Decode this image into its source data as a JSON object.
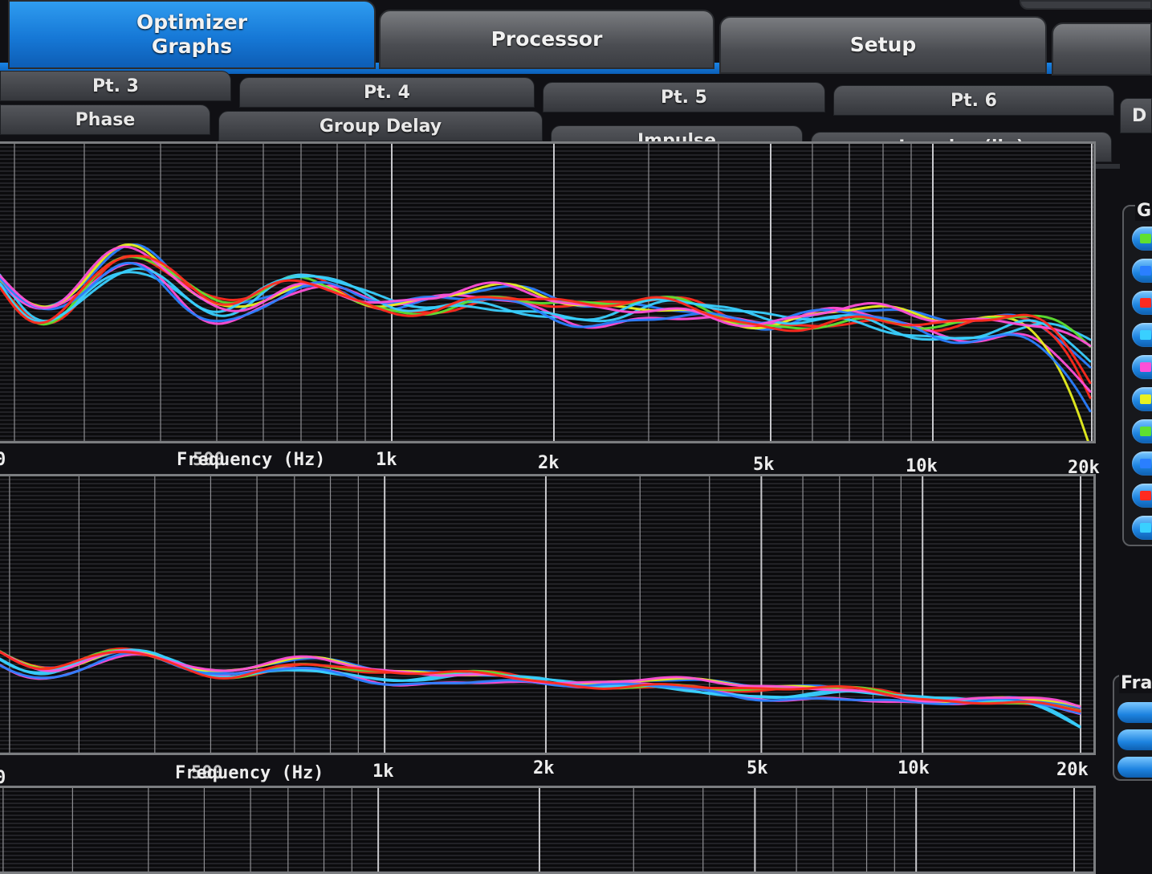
{
  "main_tabs": [
    {
      "label": "Optimizer\nGraphs",
      "active": true
    },
    {
      "label": "Processor",
      "active": false
    },
    {
      "label": "Setup",
      "active": false
    },
    {
      "label": "",
      "active": false
    }
  ],
  "point_tabs": [
    "Pt. 3",
    "Pt. 4",
    "Pt. 5",
    "Pt. 6"
  ],
  "graph_tabs": [
    "Phase",
    "Group Delay",
    "Impulse",
    "Impulse (lin)"
  ],
  "corner_tab": "D",
  "axis": {
    "title": "Frequency (Hz)",
    "overlapped_tick": "500",
    "ticks": [
      "1k",
      "2k",
      "5k",
      "10k",
      "20k"
    ],
    "left_edge_label": "0"
  },
  "side_panel_label": "G",
  "frame_panel_label": "Fra",
  "colors": {
    "accent": "#1a84e6",
    "traces": [
      "#2a7fff",
      "#ff2a1f",
      "#39d0ff",
      "#ff4fd8",
      "#e8f020",
      "#5fe030",
      "#ffa020",
      "#9a6bff"
    ]
  },
  "channel_swatches": [
    "#5fe030",
    "#2a7fff",
    "#ff2a1f",
    "#39d0ff",
    "#ff4fd8",
    "#e8f020",
    "#5fe030",
    "#2a7fff",
    "#ff2a1f",
    "#39d0ff"
  ],
  "chart_data": [
    {
      "type": "line",
      "title": "",
      "xlabel": "Frequency (Hz)",
      "x_scale": "log",
      "x_ticks": [
        "500",
        "1k",
        "2k",
        "5k",
        "10k",
        "20k"
      ],
      "series_count": 10,
      "trend": "flat with ripple; divergence below 1k, drop-off above 15k"
    },
    {
      "type": "line",
      "title": "",
      "xlabel": "Frequency (Hz)",
      "x_scale": "log",
      "x_ticks": [
        "500",
        "1k",
        "2k",
        "5k",
        "10k",
        "20k"
      ],
      "series_count": 10,
      "trend": "gently falling, tightly grouped above 1k"
    }
  ]
}
